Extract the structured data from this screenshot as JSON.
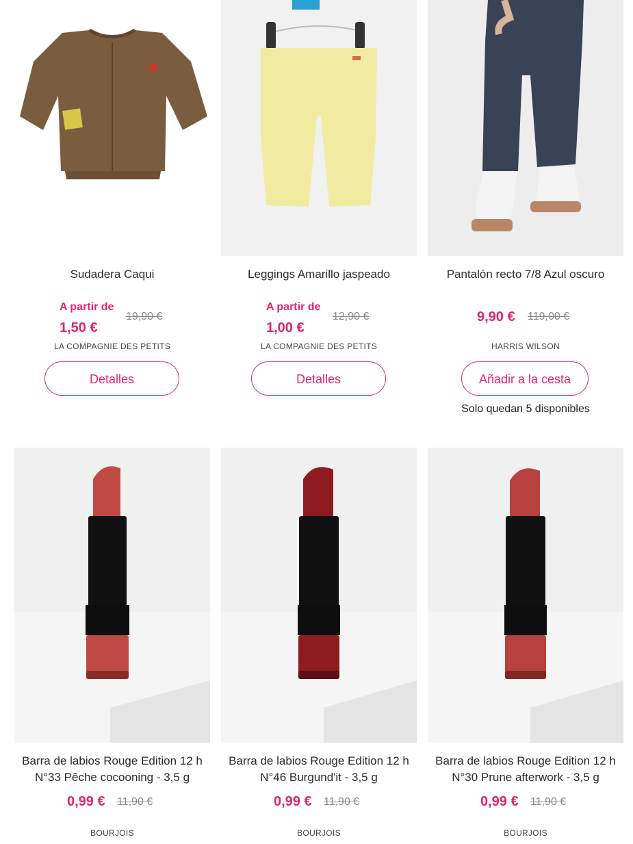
{
  "products": [
    {
      "name": "Sudadera Caqui",
      "from_label": "A partir de",
      "price": "1,50 €",
      "old_price": "19,90 €",
      "brand": "LA COMPAGNIE DES PETITS",
      "button": "Detalles",
      "image_icon": "khaki-sweatshirt-image"
    },
    {
      "name": "Leggings Amarillo jaspeado",
      "from_label": "A partir de",
      "price": "1,00 €",
      "old_price": "12,90 €",
      "brand": "LA COMPAGNIE DES PETITS",
      "button": "Detalles",
      "image_icon": "yellow-leggings-image"
    },
    {
      "name": "Pantalón recto 7/8 Azul oscuro",
      "price": "9,90 €",
      "old_price": "119,00 €",
      "brand": "HARRIS WILSON",
      "button": "Añadir a la cesta",
      "stock_note": "Solo quedan 5 disponibles",
      "image_icon": "navy-trousers-image"
    },
    {
      "name_line1": "Barra de labios Rouge Edition 12 h",
      "name_line2": "N°33 Pêche cocooning - 3,5 g",
      "price": "0,99 €",
      "old_price": "11,90 €",
      "brand": "BOURJOIS",
      "image_icon": "lipstick-image",
      "accent": "#c24a44"
    },
    {
      "name_line1": "Barra de labios Rouge Edition 12 h",
      "name_line2": "N°46 Burgund'it - 3,5 g",
      "price": "0,99 €",
      "old_price": "11,90 €",
      "brand": "BOURJOIS",
      "image_icon": "lipstick-image",
      "accent": "#8e1c20"
    },
    {
      "name_line1": "Barra de labios Rouge Edition 12 h",
      "name_line2": "N°30 Prune afterwork - 3,5 g",
      "price": "0,99 €",
      "old_price": "11,90 €",
      "brand": "BOURJOIS",
      "image_icon": "lipstick-image",
      "accent": "#b8403e"
    }
  ],
  "colors": {
    "accent": "#e0246f",
    "old_price": "#888888"
  }
}
